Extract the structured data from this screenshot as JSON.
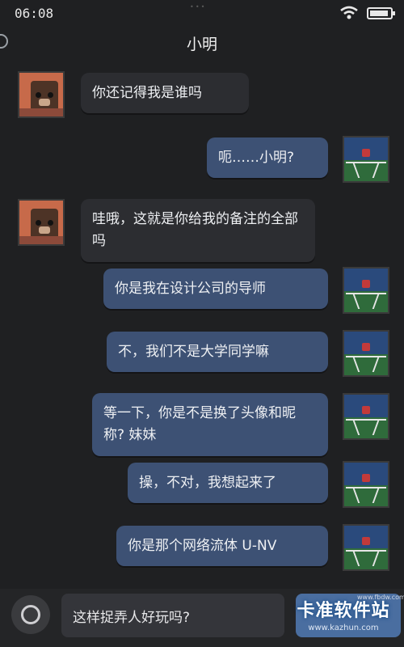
{
  "status_bar": {
    "time": "06:08",
    "dots": "•••",
    "wifi_icon": "wifi-icon",
    "battery_icon": "battery-icon",
    "battery_level": 0.9
  },
  "header": {
    "title": "小明",
    "back_icon": "back-icon"
  },
  "messages": [
    {
      "side": "in",
      "text": "你还记得我是谁吗"
    },
    {
      "side": "out",
      "text": "呃……小明?"
    },
    {
      "side": "in",
      "text": "哇哦，这就是你给我的备注的全部吗"
    },
    {
      "side": "out",
      "text": "你是我在设计公司的导师"
    },
    {
      "side": "out",
      "text": "不，我们不是大学同学嘛"
    },
    {
      "side": "out",
      "text": "等一下，你是不是换了头像和昵称? 妹妹"
    },
    {
      "side": "out",
      "text": "操，不对，我想起来了"
    },
    {
      "side": "out",
      "text": "你是那个网络流体 U-NV"
    }
  ],
  "input": {
    "camera_icon": "camera-icon",
    "draft": "这样捉弄人好玩吗?"
  },
  "watermark": {
    "main": "卡准软件站",
    "url": "www.kazhun.com",
    "small": "www.fbdw.com"
  },
  "colors": {
    "background": "#1f2022",
    "incoming_bubble": "#2c2d31",
    "outgoing_bubble": "#3d5174",
    "send_button": "#4a6ea0"
  }
}
